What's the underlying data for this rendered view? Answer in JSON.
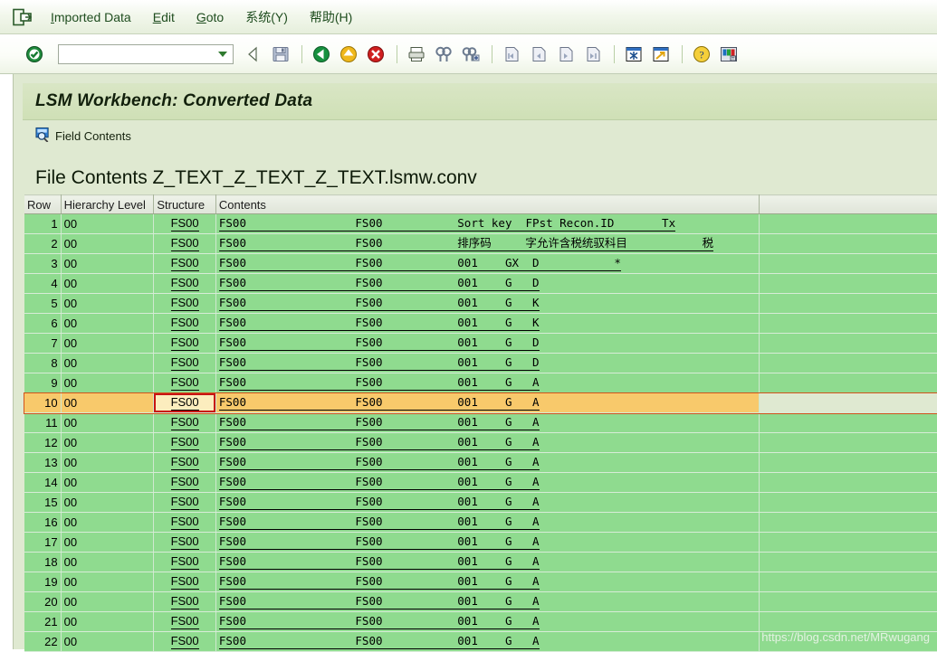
{
  "menu": {
    "app_icon": "exit-door-icon",
    "items": [
      {
        "name": "imported-data",
        "label": "Imported Data",
        "accel": "I"
      },
      {
        "name": "edit",
        "label": "Edit",
        "accel": "E"
      },
      {
        "name": "goto",
        "label": "Goto",
        "accel": "G"
      },
      {
        "name": "system",
        "label": "系统(Y)",
        "accel": "Y"
      },
      {
        "name": "help",
        "label": "帮助(H)",
        "accel": "H"
      }
    ]
  },
  "toolbar": {
    "command_value": "",
    "command_placeholder": "",
    "icons": [
      "enter-check-icon",
      "back-arrow-icon",
      "save-icon",
      "back-icon",
      "exit-icon",
      "cancel-icon",
      "print-icon",
      "find-icon",
      "find-next-icon",
      "first-page-icon",
      "previous-page-icon",
      "next-page-icon",
      "last-page-icon",
      "select-layout-icon",
      "export-window-icon",
      "help-icon",
      "customize-layout-icon"
    ]
  },
  "window": {
    "title": "LSM Workbench: Converted Data",
    "field_contents_label": "Field Contents",
    "field_contents_icon": "magnifier-screen-icon"
  },
  "report": {
    "heading": "File Contents Z_TEXT_Z_TEXT_Z_TEXT.lsmw.conv",
    "columns": [
      {
        "name": "row",
        "label": "Row"
      },
      {
        "name": "hierarchy-level",
        "label": "Hierarchy Level"
      },
      {
        "name": "structure",
        "label": "Structure"
      },
      {
        "name": "contents",
        "label": "Contents"
      }
    ],
    "rows": [
      {
        "row": "1",
        "hier": "00",
        "structure": "FS00",
        "contents": "FS00                FS00           Sort key  FPst Recon.ID       Tx",
        "underline": true
      },
      {
        "row": "2",
        "hier": "00",
        "structure": "FS00",
        "contents": "FS00                FS00           排序码     字允许含税统驭科目           税",
        "underline": true
      },
      {
        "row": "3",
        "hier": "00",
        "structure": "FS00",
        "contents": "FS00                FS00           001    GX  D           *",
        "underline": true
      },
      {
        "row": "4",
        "hier": "00",
        "structure": "FS00",
        "contents": "FS00                FS00           001    G   D",
        "underline": true
      },
      {
        "row": "5",
        "hier": "00",
        "structure": "FS00",
        "contents": "FS00                FS00           001    G   K",
        "underline": true
      },
      {
        "row": "6",
        "hier": "00",
        "structure": "FS00",
        "contents": "FS00                FS00           001    G   K",
        "underline": true
      },
      {
        "row": "7",
        "hier": "00",
        "structure": "FS00",
        "contents": "FS00                FS00           001    G   D",
        "underline": true
      },
      {
        "row": "8",
        "hier": "00",
        "structure": "FS00",
        "contents": "FS00                FS00           001    G   D",
        "underline": true
      },
      {
        "row": "9",
        "hier": "00",
        "structure": "FS00",
        "contents": "FS00                FS00           001    G   A",
        "underline": true
      },
      {
        "row": "10",
        "hier": "00",
        "structure": "FS00",
        "contents": "FS00                FS00           001    G   A",
        "underline": true,
        "selected": true
      },
      {
        "row": "11",
        "hier": "00",
        "structure": "FS00",
        "contents": "FS00                FS00           001    G   A",
        "underline": true
      },
      {
        "row": "12",
        "hier": "00",
        "structure": "FS00",
        "contents": "FS00                FS00           001    G   A",
        "underline": true
      },
      {
        "row": "13",
        "hier": "00",
        "structure": "FS00",
        "contents": "FS00                FS00           001    G   A",
        "underline": true
      },
      {
        "row": "14",
        "hier": "00",
        "structure": "FS00",
        "contents": "FS00                FS00           001    G   A",
        "underline": true
      },
      {
        "row": "15",
        "hier": "00",
        "structure": "FS00",
        "contents": "FS00                FS00           001    G   A",
        "underline": true
      },
      {
        "row": "16",
        "hier": "00",
        "structure": "FS00",
        "contents": "FS00                FS00           001    G   A",
        "underline": true
      },
      {
        "row": "17",
        "hier": "00",
        "structure": "FS00",
        "contents": "FS00                FS00           001    G   A",
        "underline": true
      },
      {
        "row": "18",
        "hier": "00",
        "structure": "FS00",
        "contents": "FS00                FS00           001    G   A",
        "underline": true
      },
      {
        "row": "19",
        "hier": "00",
        "structure": "FS00",
        "contents": "FS00                FS00           001    G   A",
        "underline": true
      },
      {
        "row": "20",
        "hier": "00",
        "structure": "FS00",
        "contents": "FS00                FS00           001    G   A",
        "underline": true
      },
      {
        "row": "21",
        "hier": "00",
        "structure": "FS00",
        "contents": "FS00                FS00           001    G   A",
        "underline": true
      },
      {
        "row": "22",
        "hier": "00",
        "structure": "FS00",
        "contents": "FS00                FS00           001    G   A",
        "underline": true
      }
    ]
  },
  "watermark": "https://blog.csdn.net/MRwugang",
  "colors": {
    "row_green": "#8fdb8f",
    "selected_row": "#f8c96b",
    "selected_cell": "#fcedbe",
    "selected_cell_border": "#c81414",
    "page_background": "#dfe9d1",
    "title_background": "#d4e3bd"
  }
}
